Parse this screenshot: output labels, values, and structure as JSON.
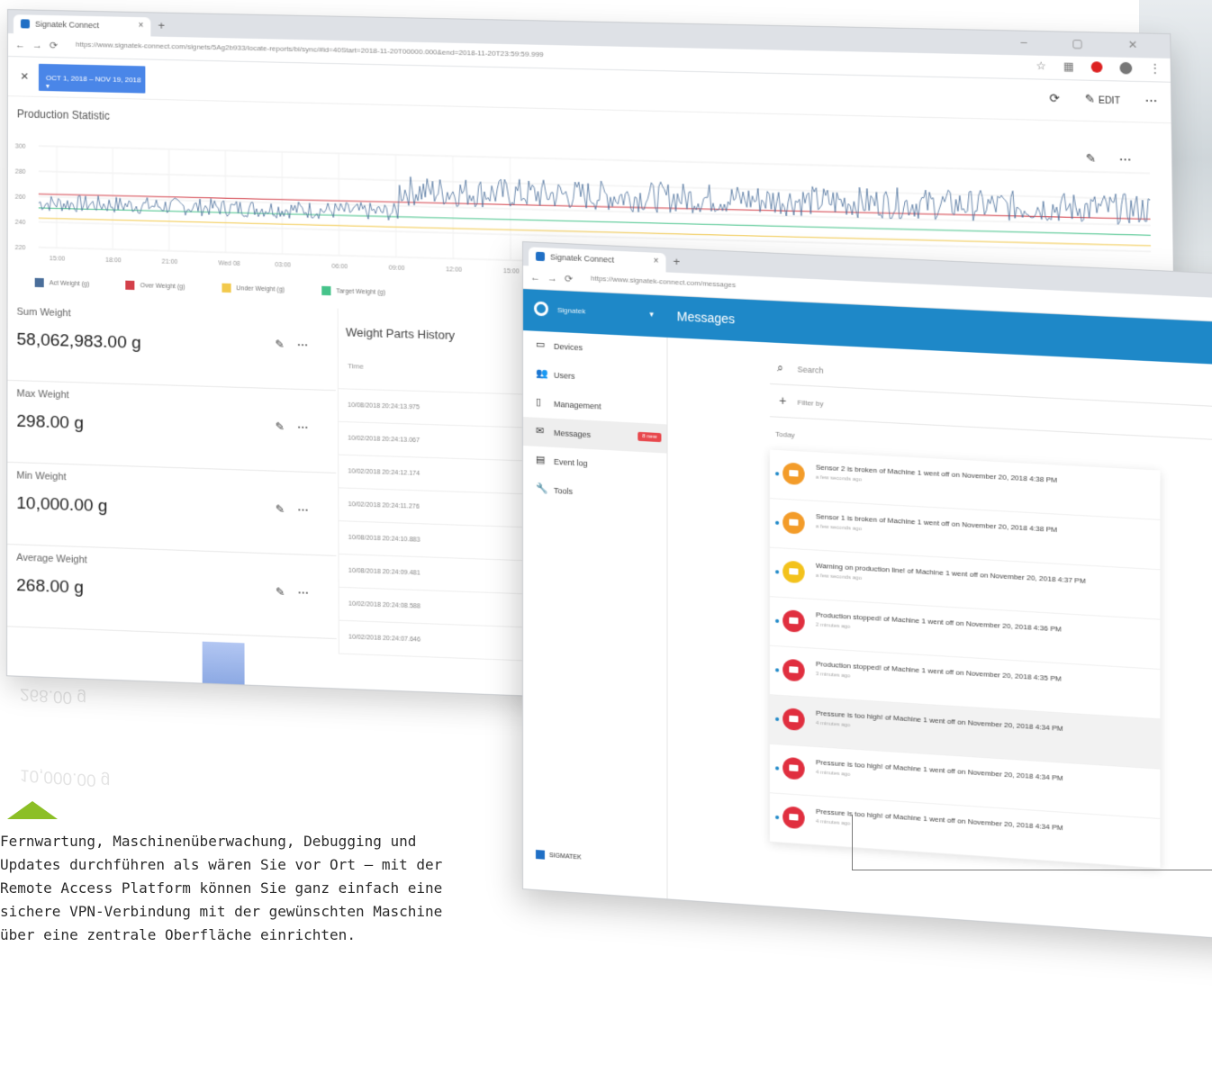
{
  "dashboard": {
    "tab_title": "Signatek Connect",
    "tab_close": "×",
    "new_tab": "+",
    "window_controls": "–  ▢  ✕",
    "url": "https://www.signatek-connect.com/signets/5Ag2b933/locate-reports/bi/sync/#id=40Start=2018-11-20T00000.000&end=2018-11-20T23:59:59.999",
    "close_label": "×",
    "date_range": "OCT 1, 2018 – NOV 19, 2018 ▾",
    "edit_label": "EDIT",
    "refresh_icon": "refresh-icon",
    "more_icon": "more-icon",
    "chart_title": "Production Statistic",
    "stats": [
      {
        "label": "Sum Weight",
        "value": "58,062,983.00 g"
      },
      {
        "label": "Max Weight",
        "value": "298.00 g"
      },
      {
        "label": "Min Weight",
        "value": "10,000.00 g"
      },
      {
        "label": "Average Weight",
        "value": "268.00 g"
      }
    ],
    "history": {
      "title": "Weight Parts History",
      "column": "Time",
      "rows": [
        "10/08/2018 20:24:13.975",
        "10/02/2018 20:24:13.067",
        "10/02/2018 20:24:12.174",
        "10/02/2018 20:24:11.276",
        "10/08/2018 20:24:10.883",
        "10/08/2018 20:24:09.481",
        "10/02/2018 20:24:08.588",
        "10/02/2018 20:24:07.646"
      ]
    }
  },
  "chart_data": {
    "type": "line",
    "title": "Production Statistic",
    "x_tick_labels": [
      "15:00",
      "18:00",
      "21:00",
      "Wed 08",
      "03:00",
      "06:00",
      "09:00",
      "12:00",
      "15:00"
    ],
    "y_tick_labels": [
      "300",
      "280",
      "260",
      "240",
      "220"
    ],
    "ylim": [
      220,
      300
    ],
    "series": [
      {
        "name": "Act Weight (g)",
        "color": "#4a6e9a"
      },
      {
        "name": "Over Weight (g)",
        "color": "#d3404a"
      },
      {
        "name": "Under Weight (g)",
        "color": "#f2c94c"
      },
      {
        "name": "Target Weight (g)",
        "color": "#46c38a"
      }
    ],
    "levels": {
      "phase1_mean": 255,
      "phase2_mean": 272,
      "over": 262,
      "under": 243,
      "target": 251
    }
  },
  "messages_window": {
    "tab_title": "Signatek Connect",
    "tab_close": "×",
    "new_tab": "+",
    "url": "https://www.signatek-connect.com/messages",
    "account": "Signatek",
    "app_title": "Messages",
    "nav": [
      {
        "label": "Devices",
        "icon": "devices-icon",
        "glyph": "▭"
      },
      {
        "label": "Users",
        "icon": "users-icon",
        "glyph": "👥"
      },
      {
        "label": "Management",
        "icon": "management-icon",
        "glyph": "▯"
      },
      {
        "label": "Messages",
        "icon": "messages-icon",
        "glyph": "✉",
        "badge": "8 new",
        "active": true
      },
      {
        "label": "Event log",
        "icon": "event-log-icon",
        "glyph": "▤"
      },
      {
        "label": "Tools",
        "icon": "tools-icon",
        "glyph": "🔧"
      }
    ],
    "brand_footer": "SIGMATEK",
    "search_placeholder": "Search",
    "filter_label": "Filter by",
    "day_label": "Today",
    "messages": [
      {
        "text": "Sensor 2 is broken of Machine 1 went off on November 20, 2018 4:38 PM",
        "time": "a few seconds ago",
        "color": "#f39c2a"
      },
      {
        "text": "Sensor 1 is broken of Machine 1 went off on November 20, 2018 4:38 PM",
        "time": "a few seconds ago",
        "color": "#f39c2a"
      },
      {
        "text": "Warning on production line! of Machine 1 went off on November 20, 2018 4:37 PM",
        "time": "a few seconds ago",
        "color": "#f3c21c"
      },
      {
        "text": "Production stopped! of Machine 1 went off on November 20, 2018 4:36 PM",
        "time": "2 minutes ago",
        "color": "#e02f3f"
      },
      {
        "text": "Production stopped! of Machine 1 went off on November 20, 2018 4:35 PM",
        "time": "3 minutes ago",
        "color": "#e02f3f"
      },
      {
        "text": "Pressure is too high! of Machine 1 went off on November 20, 2018 4:34 PM",
        "time": "4 minutes ago",
        "color": "#e02f3f"
      },
      {
        "text": "Pressure is too high! of Machine 1 went off on November 20, 2018 4:34 PM",
        "time": "4 minutes ago",
        "color": "#e02f3f"
      },
      {
        "text": "Pressure is too high! of Machine 1 went off on November 20, 2018 4:34 PM",
        "time": "4 minutes ago",
        "color": "#e02f3f"
      }
    ]
  },
  "caption": {
    "lines": [
      "Fernwartung, Maschinenüberwachung, Debugging und",
      "Updates durchführen als wären Sie vor Ort – mit der",
      "Remote Access Platform können Sie ganz einfach eine",
      "sichere VPN-Verbindung mit der gewünschten Maschine",
      "über eine zentrale Oberfläche einrichten."
    ],
    "accent_color": "#8cbf26"
  }
}
